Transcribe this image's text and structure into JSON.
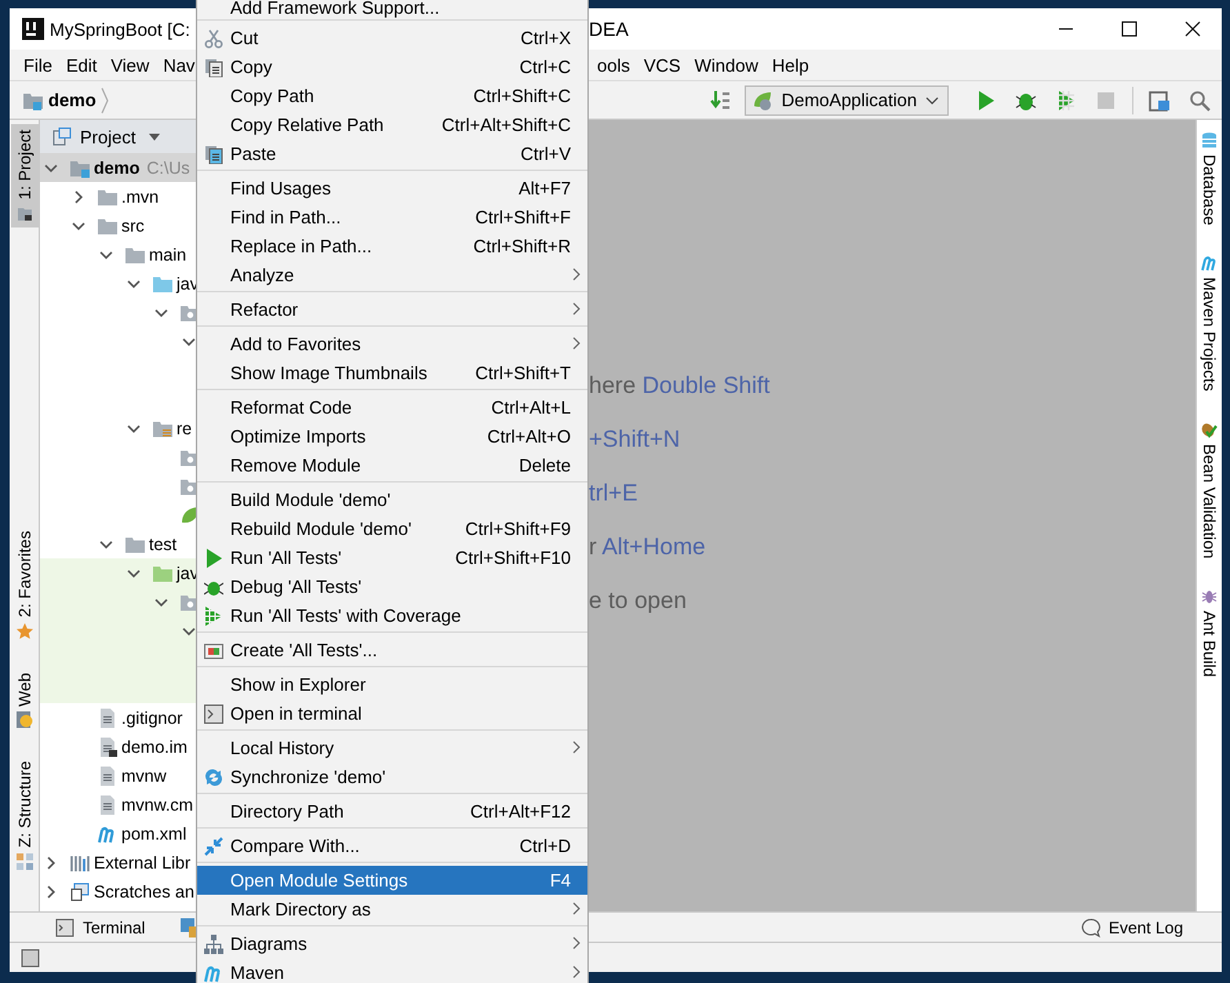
{
  "window": {
    "title_start": "MySpringBoot [C:",
    "title_end": "DEA"
  },
  "menu_bar": {
    "left": [
      "File",
      "Edit",
      "View",
      "Nav"
    ],
    "right": [
      "ools",
      "VCS",
      "Window",
      "Help"
    ]
  },
  "nav_bar": {
    "breadcrumb": "demo",
    "run_config": "DemoApplication",
    "toolbar": [
      {
        "kind": "run",
        "disabled": false
      },
      {
        "kind": "debug",
        "disabled": false
      },
      {
        "kind": "coverage",
        "disabled": false
      },
      {
        "kind": "stop",
        "disabled": true
      }
    ]
  },
  "left_stripe": [
    {
      "label": "1: Project",
      "selected": true
    },
    {
      "label": "2: Favorites",
      "selected": false
    },
    {
      "label": "Web",
      "selected": false
    },
    {
      "label": "Z: Structure",
      "selected": false
    }
  ],
  "project_panel": {
    "title": "Project",
    "tree": [
      {
        "label": "demo",
        "path": "C:\\Us",
        "kind": "module",
        "expanded": true,
        "selected": true,
        "children": [
          {
            "label": ".mvn",
            "kind": "folder",
            "expanded": false,
            "selected": false
          },
          {
            "label": "src",
            "kind": "folder",
            "expanded": true,
            "selected": false,
            "children": [
              {
                "label": "main",
                "kind": "folder",
                "expanded": true,
                "selected": false,
                "children": [
                  {
                    "label": "jav",
                    "kind": "source-root",
                    "expanded": true,
                    "selected": false,
                    "children": [
                      {
                        "kind": "package",
                        "expanded": true,
                        "selected": false,
                        "children": [
                          {
                            "expanded": true,
                            "selected": false,
                            "children": [
                              {
                                "selected": false
                              },
                              {
                                "selected": false
                              }
                            ]
                          }
                        ]
                      }
                    ]
                  },
                  {
                    "label": "re",
                    "kind": "resources-root",
                    "expanded": true,
                    "selected": false,
                    "children": [
                      {
                        "kind": "package",
                        "selected": false
                      },
                      {
                        "kind": "package",
                        "selected": false
                      },
                      {
                        "kind": "spring-file",
                        "selected": false
                      }
                    ]
                  }
                ]
              },
              {
                "label": "test",
                "kind": "folder",
                "expanded": true,
                "selected": false,
                "children": [
                  {
                    "label": "jav",
                    "kind": "test-root",
                    "expanded": true,
                    "selected": false,
                    "children": [
                      {
                        "kind": "package",
                        "expanded": true,
                        "selected": false,
                        "children": [
                          {
                            "expanded": true,
                            "selected": false,
                            "children": [
                              {
                                "selected": false
                              },
                              {
                                "selected": false
                              }
                            ]
                          }
                        ]
                      }
                    ]
                  }
                ]
              }
            ]
          },
          {
            "label": ".gitignor",
            "kind": "file",
            "selected": false
          },
          {
            "label": "demo.im",
            "kind": "iml-file",
            "selected": false
          },
          {
            "label": "mvnw",
            "kind": "file",
            "selected": false
          },
          {
            "label": "mvnw.cm",
            "kind": "file",
            "selected": false
          },
          {
            "label": "pom.xml",
            "kind": "maven-file",
            "selected": false
          }
        ]
      },
      {
        "label": "External Libr",
        "kind": "libraries",
        "expanded": false,
        "selected": false
      },
      {
        "label": "Scratches an",
        "kind": "scratches",
        "expanded": false,
        "selected": false
      }
    ]
  },
  "editor": {
    "hints": [
      {
        "text": "here ",
        "key": "Double Shift"
      },
      {
        "key": "+Shift+N"
      },
      {
        "key": "trl+E"
      },
      {
        "text": "r ",
        "key": "Alt+Home"
      },
      {
        "text": "e to open"
      }
    ]
  },
  "right_stripe": [
    "Database",
    "Maven Projects",
    "Bean Validation",
    "Ant Build"
  ],
  "bottom_bar": {
    "tabs": [
      "Terminal"
    ],
    "event_log": "Event Log"
  },
  "context_menu": {
    "groups": [
      {
        "items": [
          {
            "label": "Add Framework Support...",
            "selected": false
          }
        ]
      },
      {
        "items": [
          {
            "label": "Cut",
            "shortcut": "Ctrl+X",
            "selected": false
          },
          {
            "label": "Copy",
            "shortcut": "Ctrl+C",
            "selected": false
          },
          {
            "label": "Copy Path",
            "shortcut": "Ctrl+Shift+C",
            "selected": false
          },
          {
            "label": "Copy Relative Path",
            "shortcut": "Ctrl+Alt+Shift+C",
            "selected": false
          },
          {
            "label": "Paste",
            "shortcut": "Ctrl+V",
            "selected": false
          }
        ]
      },
      {
        "items": [
          {
            "label": "Find Usages",
            "shortcut": "Alt+F7",
            "selected": false
          },
          {
            "label": "Find in Path...",
            "shortcut": "Ctrl+Shift+F",
            "selected": false
          },
          {
            "label": "Replace in Path...",
            "shortcut": "Ctrl+Shift+R",
            "selected": false
          },
          {
            "label": "Analyze",
            "submenu": true,
            "selected": false
          }
        ]
      },
      {
        "items": [
          {
            "label": "Refactor",
            "submenu": true,
            "selected": false
          }
        ]
      },
      {
        "items": [
          {
            "label": "Add to Favorites",
            "submenu": true,
            "selected": false
          },
          {
            "label": "Show Image Thumbnails",
            "shortcut": "Ctrl+Shift+T",
            "selected": false
          }
        ]
      },
      {
        "items": [
          {
            "label": "Reformat Code",
            "shortcut": "Ctrl+Alt+L",
            "selected": false
          },
          {
            "label": "Optimize Imports",
            "shortcut": "Ctrl+Alt+O",
            "selected": false
          },
          {
            "label": "Remove Module",
            "shortcut": "Delete",
            "selected": false
          }
        ]
      },
      {
        "items": [
          {
            "label": "Build Module 'demo'",
            "selected": false
          },
          {
            "label": "Rebuild Module 'demo'",
            "shortcut": "Ctrl+Shift+F9",
            "selected": false
          },
          {
            "label": "Run 'All Tests'",
            "shortcut": "Ctrl+Shift+F10",
            "selected": false
          },
          {
            "label": "Debug 'All Tests'",
            "selected": false
          },
          {
            "label": "Run 'All Tests' with Coverage",
            "selected": false
          }
        ]
      },
      {
        "items": [
          {
            "label": "Create 'All Tests'...",
            "selected": false
          }
        ]
      },
      {
        "items": [
          {
            "label": "Show in Explorer",
            "selected": false
          },
          {
            "label": "Open in terminal",
            "selected": false
          }
        ]
      },
      {
        "items": [
          {
            "label": "Local History",
            "submenu": true,
            "selected": false
          },
          {
            "label": "Synchronize 'demo'",
            "selected": false
          }
        ]
      },
      {
        "items": [
          {
            "label": "Directory Path",
            "shortcut": "Ctrl+Alt+F12",
            "selected": false
          }
        ]
      },
      {
        "items": [
          {
            "label": "Compare With...",
            "shortcut": "Ctrl+D",
            "selected": false
          }
        ]
      },
      {
        "items": [
          {
            "label": "Open Module Settings",
            "shortcut": "F4",
            "selected": true
          },
          {
            "label": "Mark Directory as",
            "submenu": true,
            "selected": false
          }
        ]
      },
      {
        "items": [
          {
            "label": "Diagrams",
            "submenu": true,
            "selected": false
          },
          {
            "label": "Maven",
            "submenu": true,
            "selected": false
          }
        ]
      }
    ]
  }
}
